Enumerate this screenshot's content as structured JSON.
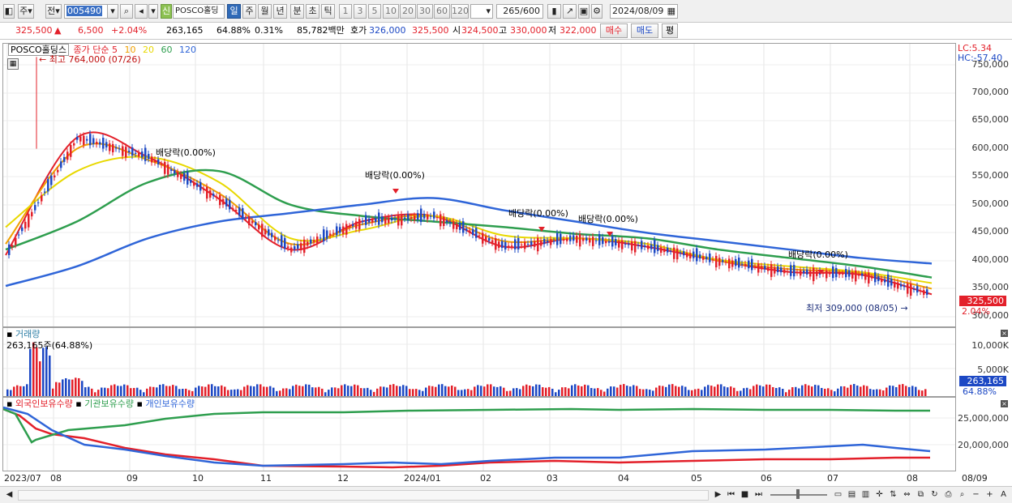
{
  "toolbar": {
    "period_short": "주",
    "prev_label": "전",
    "code": "005490",
    "name": "POSCO홀딩스",
    "tag_new": "신",
    "periods": [
      "일",
      "주",
      "월",
      "년",
      "분",
      "초",
      "틱"
    ],
    "active_period": "일",
    "nums": [
      "1",
      "3",
      "5",
      "10",
      "20",
      "30",
      "60",
      "120"
    ],
    "count": "265",
    "total": "/600",
    "date": "2024/08/09"
  },
  "quote": {
    "price": "325,500",
    "change": "6,500",
    "pct": "+2.04%",
    "volume": "263,165",
    "vol_ratio": "64.88%",
    "turnover": "0.31%",
    "amount": "85,782백만",
    "bid_label": "호가",
    "bid1": "326,000",
    "bid2": "325,500",
    "open_label": "시",
    "open": "324,500",
    "high_label": "고",
    "high": "330,000",
    "low_label": "저",
    "low": "322,000",
    "buy": "매수",
    "sell": "매도",
    "eval": "평"
  },
  "price_panel": {
    "title": "POSCO홀딩스",
    "series_label": "종가 단순",
    "ma": [
      {
        "label": "5",
        "color": "#e3202a"
      },
      {
        "label": "10",
        "color": "#f0a000"
      },
      {
        "label": "20",
        "color": "#e8d800"
      },
      {
        "label": "60",
        "color": "#2e9e4e"
      },
      {
        "label": "120",
        "color": "#2f65d8"
      }
    ],
    "high_note": "최고 764,000 (07/26)",
    "low_note": "최저 309,000 (08/05)",
    "lc": "LC:5.34",
    "hc": "HC:-57.40",
    "dividends": [
      {
        "text": "배당락(0.00%)"
      },
      {
        "text": "배당락(0.00%)"
      },
      {
        "text": "배당락(0.00%)"
      },
      {
        "text": "배당락(0.00%)"
      },
      {
        "text": "배당락(0.00%)"
      }
    ],
    "yticks": [
      "750,000",
      "700,000",
      "650,000",
      "600,000",
      "550,000",
      "500,000",
      "450,000",
      "400,000",
      "350,000",
      "300,000"
    ],
    "price_tag": "325,500",
    "pct_tag": "2.04%"
  },
  "volume_panel": {
    "title": "거래량",
    "value": "263,165주(64.88%)",
    "yticks": [
      "10,000K",
      "5,000K"
    ],
    "vol_tag": "263,165",
    "pct_tag": "64.88%"
  },
  "holdings_panel": {
    "titles": [
      "외국인보유수량",
      "기관보유수량",
      "개인보유수량"
    ],
    "title_colors": [
      "#e3202a",
      "#2e9e4e",
      "#2f65d8"
    ],
    "yticks": [
      "25,000,000",
      "20,000,000"
    ]
  },
  "xaxis": [
    "2023/07",
    "08",
    "09",
    "10",
    "11",
    "12",
    "2024/01",
    "02",
    "03",
    "04",
    "05",
    "06",
    "07",
    "08",
    "08/09"
  ],
  "chart_data": {
    "type": "line",
    "title": "",
    "xlabel": "",
    "ylabel": "",
    "ylim": [
      290000,
      770000
    ],
    "x": [
      "2023/07",
      "2023/08",
      "2023/09",
      "2023/10",
      "2023/11",
      "2023/12",
      "2024/01",
      "2024/02",
      "2024/03",
      "2024/04",
      "2024/05",
      "2024/06",
      "2024/07",
      "2024/08"
    ],
    "series": [
      {
        "name": "5",
        "values": [
          410000,
          620000,
          585000,
          510000,
          420000,
          470000,
          480000,
          425000,
          440000,
          425000,
          400000,
          380000,
          375000,
          340000
        ]
      },
      {
        "name": "10",
        "values": [
          430000,
          600000,
          580000,
          520000,
          430000,
          465000,
          480000,
          435000,
          440000,
          430000,
          400000,
          385000,
          378000,
          350000
        ]
      },
      {
        "name": "20",
        "values": [
          460000,
          560000,
          585000,
          540000,
          440000,
          455000,
          480000,
          445000,
          440000,
          430000,
          402000,
          390000,
          380000,
          360000
        ]
      },
      {
        "name": "60",
        "values": [
          420000,
          470000,
          540000,
          560000,
          500000,
          480000,
          470000,
          460000,
          448000,
          440000,
          420000,
          405000,
          390000,
          370000
        ]
      },
      {
        "name": "120",
        "values": [
          355000,
          390000,
          440000,
          470000,
          485000,
          500000,
          512000,
          490000,
          470000,
          450000,
          435000,
          420000,
          405000,
          395000
        ]
      }
    ]
  }
}
